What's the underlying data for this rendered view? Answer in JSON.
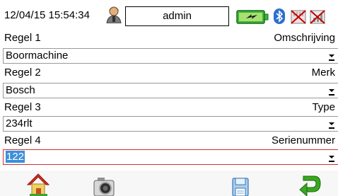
{
  "status_bar": {
    "datetime": "12/04/15 15:54:34",
    "username": "admin",
    "icons": [
      "user-icon",
      "battery-charging-icon",
      "bluetooth-icon",
      "sd-card-disabled-icon",
      "network-disabled-icon"
    ]
  },
  "rules": [
    {
      "label": "Regel 1",
      "description": "Omschrijving",
      "value": "Boormachine"
    },
    {
      "label": "Regel 2",
      "description": "Merk",
      "value": "Bosch"
    },
    {
      "label": "Regel 3",
      "description": "Type",
      "value": "234rlt"
    },
    {
      "label": "Regel 4",
      "description": "Serienummer",
      "value": "122"
    }
  ],
  "toolbar": {
    "icons": [
      "home-icon",
      "camera-icon",
      "save-icon",
      "back-icon"
    ]
  },
  "colors": {
    "active_border": "#d23030",
    "selection": "#3c8fd8",
    "battery_green": "#3cb43c",
    "disabled_red": "#c00000"
  }
}
